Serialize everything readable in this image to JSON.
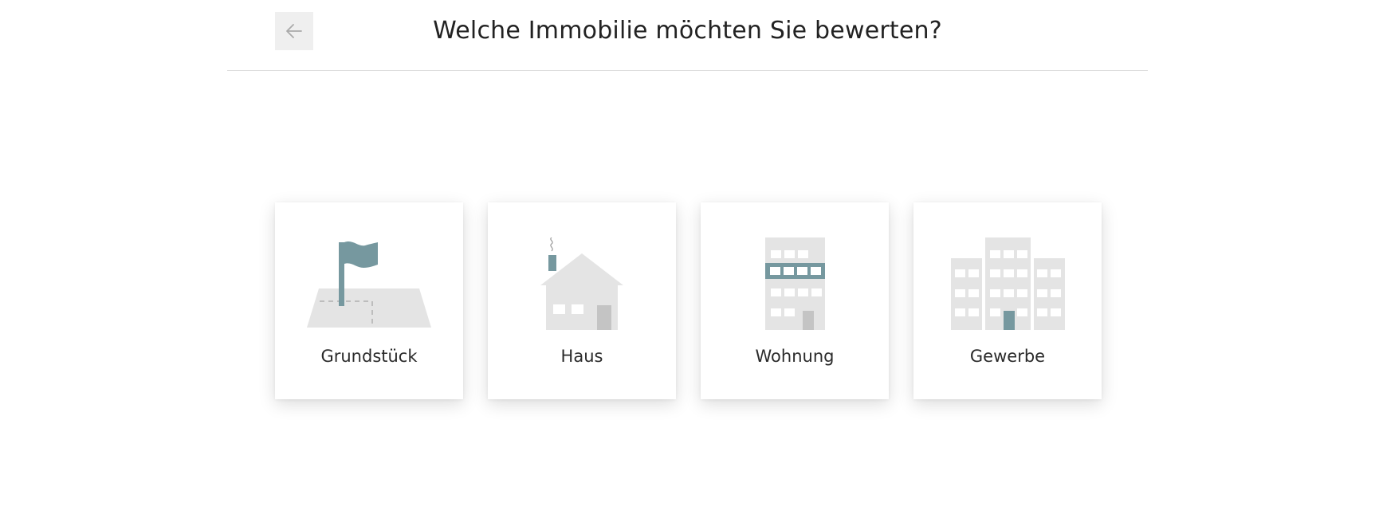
{
  "header": {
    "title": "Welche Immobilie möchten Sie bewerten?",
    "back_icon": "arrow-left-icon"
  },
  "property_types": [
    {
      "label": "Grundstück",
      "icon": "flag-plot-icon"
    },
    {
      "label": "Haus",
      "icon": "house-icon"
    },
    {
      "label": "Wohnung",
      "icon": "apartment-building-icon"
    },
    {
      "label": "Gewerbe",
      "icon": "commercial-buildings-icon"
    }
  ],
  "colors": {
    "accent": "#76989f",
    "icon_gray": "#e4e4e4",
    "door_gray": "#c4c4c4",
    "divider": "#dddddd",
    "back_button_bg": "#efefef"
  }
}
